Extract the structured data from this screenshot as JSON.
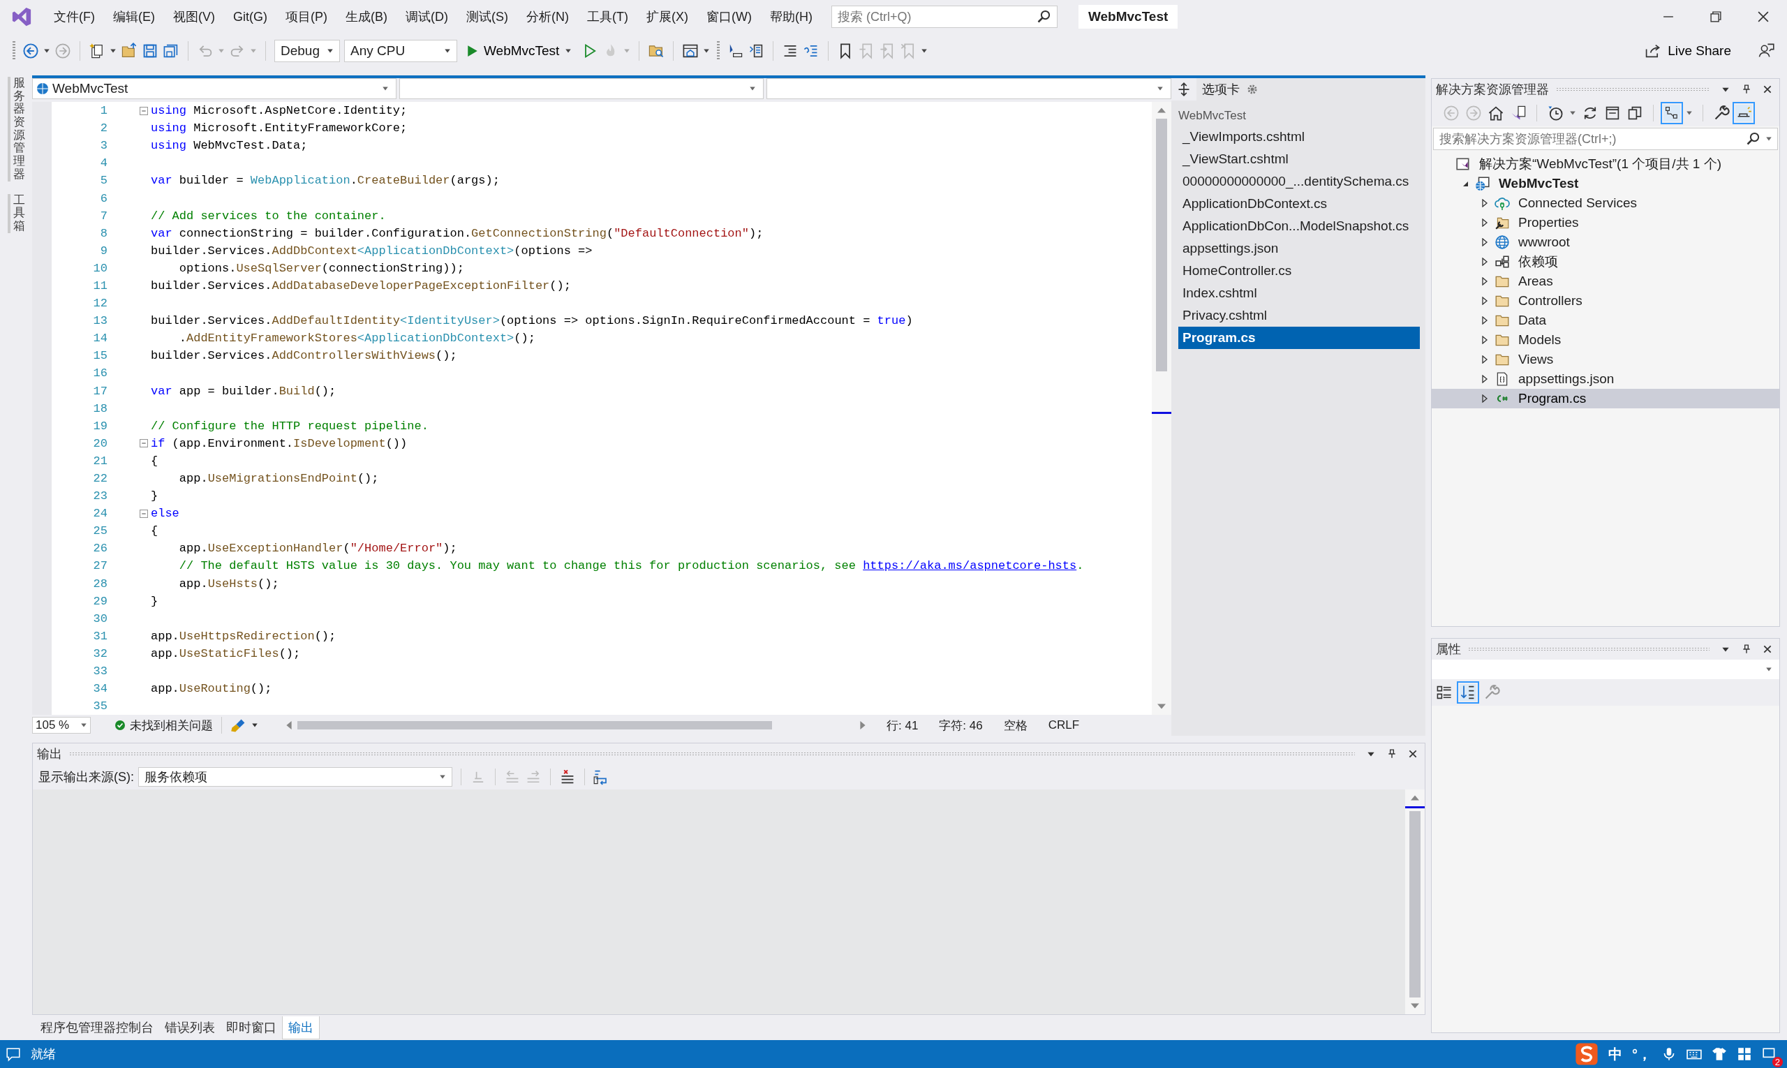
{
  "title_bar": {
    "menus": [
      "文件(F)",
      "编辑(E)",
      "视图(V)",
      "Git(G)",
      "项目(P)",
      "生成(B)",
      "调试(D)",
      "测试(S)",
      "分析(N)",
      "工具(T)",
      "扩展(X)",
      "窗口(W)",
      "帮助(H)"
    ],
    "search": {
      "placeholder": "搜索 (Ctrl+Q)"
    },
    "title": "WebMvcTest"
  },
  "toolbar": {
    "configuration": "Debug",
    "platform": "Any CPU",
    "start_label": "WebMvcTest",
    "live_share": "Live Share"
  },
  "side_strip": [
    "服务器资源管理器",
    "工具箱"
  ],
  "editor": {
    "project_dropdown": "WebMvcTest",
    "lines": [
      {
        "number": "1",
        "fold": true,
        "segments": [
          {
            "kind": "keyword",
            "text": "using"
          },
          {
            "kind": "plain",
            "text": " Microsoft.AspNetCore.Identity;"
          }
        ]
      },
      {
        "number": "2",
        "fold": false,
        "segments": [
          {
            "kind": "keyword",
            "text": "using"
          },
          {
            "kind": "plain",
            "text": " Microsoft.EntityFrameworkCore;"
          }
        ]
      },
      {
        "number": "3",
        "fold": false,
        "segments": [
          {
            "kind": "keyword",
            "text": "using"
          },
          {
            "kind": "plain",
            "text": " WebMvcTest.Data;"
          }
        ]
      },
      {
        "number": "4",
        "fold": false
      },
      {
        "number": "5",
        "fold": false,
        "segments": [
          {
            "kind": "keyword",
            "text": "var"
          },
          {
            "kind": "plain",
            "text": " builder = "
          },
          {
            "kind": "type",
            "text": "WebApplication"
          },
          {
            "kind": "plain",
            "text": "."
          },
          {
            "kind": "method",
            "text": "CreateBuilder"
          },
          {
            "kind": "plain",
            "text": "(args);"
          }
        ]
      },
      {
        "number": "6",
        "fold": false
      },
      {
        "number": "7",
        "fold": false,
        "segments": [
          {
            "kind": "comment",
            "text": "// Add services to the container."
          }
        ]
      },
      {
        "number": "8",
        "fold": false,
        "segments": [
          {
            "kind": "keyword",
            "text": "var"
          },
          {
            "kind": "plain",
            "text": " connectionString = builder.Configuration."
          },
          {
            "kind": "method",
            "text": "GetConnectionString"
          },
          {
            "kind": "plain",
            "text": "("
          },
          {
            "kind": "string",
            "text": "\"DefaultConnection\""
          },
          {
            "kind": "plain",
            "text": ");"
          }
        ]
      },
      {
        "number": "9",
        "fold": false,
        "segments": [
          {
            "kind": "plain",
            "text": "builder.Services."
          },
          {
            "kind": "method",
            "text": "AddDbContext"
          },
          {
            "kind": "type",
            "text": "<ApplicationDbContext>"
          },
          {
            "kind": "plain",
            "text": "(options =>"
          }
        ]
      },
      {
        "number": "10",
        "fold": false,
        "segments": [
          {
            "kind": "plain",
            "text": "    options."
          },
          {
            "kind": "method",
            "text": "UseSqlServer"
          },
          {
            "kind": "plain",
            "text": "(connectionString));"
          }
        ]
      },
      {
        "number": "11",
        "fold": false,
        "segments": [
          {
            "kind": "plain",
            "text": "builder.Services."
          },
          {
            "kind": "method",
            "text": "AddDatabaseDeveloperPageExceptionFilter"
          },
          {
            "kind": "plain",
            "text": "();"
          }
        ]
      },
      {
        "number": "12",
        "fold": false
      },
      {
        "number": "13",
        "fold": false,
        "segments": [
          {
            "kind": "plain",
            "text": "builder.Services."
          },
          {
            "kind": "method",
            "text": "AddDefaultIdentity"
          },
          {
            "kind": "type",
            "text": "<IdentityUser>"
          },
          {
            "kind": "plain",
            "text": "(options => options.SignIn.RequireConfirmedAccount = "
          },
          {
            "kind": "keyword",
            "text": "true"
          },
          {
            "kind": "plain",
            "text": ")"
          }
        ]
      },
      {
        "number": "14",
        "fold": false,
        "segments": [
          {
            "kind": "plain",
            "text": "    ."
          },
          {
            "kind": "method",
            "text": "AddEntityFrameworkStores"
          },
          {
            "kind": "type",
            "text": "<ApplicationDbContext>"
          },
          {
            "kind": "plain",
            "text": "();"
          }
        ]
      },
      {
        "number": "15",
        "fold": false,
        "segments": [
          {
            "kind": "plain",
            "text": "builder.Services."
          },
          {
            "kind": "method",
            "text": "AddControllersWithViews"
          },
          {
            "kind": "plain",
            "text": "();"
          }
        ]
      },
      {
        "number": "16",
        "fold": false
      },
      {
        "number": "17",
        "fold": false,
        "segments": [
          {
            "kind": "keyword",
            "text": "var"
          },
          {
            "kind": "plain",
            "text": " app = builder."
          },
          {
            "kind": "method",
            "text": "Build"
          },
          {
            "kind": "plain",
            "text": "();"
          }
        ]
      },
      {
        "number": "18",
        "fold": false
      },
      {
        "number": "19",
        "fold": false,
        "segments": [
          {
            "kind": "comment",
            "text": "// Configure the HTTP request pipeline."
          }
        ]
      },
      {
        "number": "20",
        "fold": true,
        "segments": [
          {
            "kind": "keyword",
            "text": "if"
          },
          {
            "kind": "plain",
            "text": " (app.Environment."
          },
          {
            "kind": "method",
            "text": "IsDevelopment"
          },
          {
            "kind": "plain",
            "text": "())"
          }
        ]
      },
      {
        "number": "21",
        "fold": false,
        "segments": [
          {
            "kind": "plain",
            "text": "{"
          }
        ]
      },
      {
        "number": "22",
        "fold": false,
        "segments": [
          {
            "kind": "plain",
            "text": "    app."
          },
          {
            "kind": "method",
            "text": "UseMigrationsEndPoint"
          },
          {
            "kind": "plain",
            "text": "();"
          }
        ]
      },
      {
        "number": "23",
        "fold": false,
        "segments": [
          {
            "kind": "plain",
            "text": "}"
          }
        ]
      },
      {
        "number": "24",
        "fold": true,
        "segments": [
          {
            "kind": "keyword",
            "text": "else"
          }
        ]
      },
      {
        "number": "25",
        "fold": false,
        "segments": [
          {
            "kind": "plain",
            "text": "{"
          }
        ]
      },
      {
        "number": "26",
        "fold": false,
        "segments": [
          {
            "kind": "plain",
            "text": "    app."
          },
          {
            "kind": "method",
            "text": "UseExceptionHandler"
          },
          {
            "kind": "plain",
            "text": "("
          },
          {
            "kind": "string",
            "text": "\"/Home/Error\""
          },
          {
            "kind": "plain",
            "text": ");"
          }
        ]
      },
      {
        "number": "27",
        "fold": false,
        "segments": [
          {
            "kind": "comment",
            "text": "    // The default HSTS value is 30 days. You may want to change this for production scenarios, see "
          },
          {
            "kind": "link",
            "text": "https://aka.ms/aspnetcore-hsts"
          },
          {
            "kind": "comment",
            "text": "."
          }
        ]
      },
      {
        "number": "28",
        "fold": false,
        "segments": [
          {
            "kind": "plain",
            "text": "    app."
          },
          {
            "kind": "method",
            "text": "UseHsts"
          },
          {
            "kind": "plain",
            "text": "();"
          }
        ]
      },
      {
        "number": "29",
        "fold": false,
        "segments": [
          {
            "kind": "plain",
            "text": "}"
          }
        ]
      },
      {
        "number": "30",
        "fold": false
      },
      {
        "number": "31",
        "fold": false,
        "segments": [
          {
            "kind": "plain",
            "text": "app."
          },
          {
            "kind": "method",
            "text": "UseHttpsRedirection"
          },
          {
            "kind": "plain",
            "text": "();"
          }
        ]
      },
      {
        "number": "32",
        "fold": false,
        "segments": [
          {
            "kind": "plain",
            "text": "app."
          },
          {
            "kind": "method",
            "text": "UseStaticFiles"
          },
          {
            "kind": "plain",
            "text": "();"
          }
        ]
      },
      {
        "number": "33",
        "fold": false
      },
      {
        "number": "34",
        "fold": false,
        "segments": [
          {
            "kind": "plain",
            "text": "app."
          },
          {
            "kind": "method",
            "text": "UseRouting"
          },
          {
            "kind": "plain",
            "text": "();"
          }
        ]
      },
      {
        "number": "35",
        "fold": false
      }
    ],
    "zoom": "105 %",
    "issues": "未找到相关问题",
    "position": [
      "行: 41",
      "字符: 46",
      "空格",
      "CRLF"
    ]
  },
  "open_tabs": {
    "title": "选项卡",
    "group": "WebMvcTest",
    "items": [
      {
        "label": "_ViewImports.cshtml",
        "selected": false
      },
      {
        "label": "_ViewStart.cshtml",
        "selected": false
      },
      {
        "label": "00000000000000_...dentitySchema.cs",
        "selected": false
      },
      {
        "label": "ApplicationDbContext.cs",
        "selected": false
      },
      {
        "label": "ApplicationDbCon...ModelSnapshot.cs",
        "selected": false
      },
      {
        "label": "appsettings.json",
        "selected": false
      },
      {
        "label": "HomeController.cs",
        "selected": false
      },
      {
        "label": "Index.cshtml",
        "selected": false
      },
      {
        "label": "Privacy.cshtml",
        "selected": false
      },
      {
        "label": "Program.cs",
        "selected": true
      }
    ]
  },
  "solution_explorer": {
    "title": "解决方案资源管理器",
    "search": {
      "placeholder": "搜索解决方案资源管理器(Ctrl+;)"
    },
    "tree": [
      {
        "label": "解决方案“WebMvcTest”(1 个项目/共 1 个)",
        "kind": "solution",
        "selected": false,
        "children": [
          {
            "label": "WebMvcTest",
            "kind": "project",
            "expanded": true,
            "selected": false,
            "children": [
              {
                "label": "Connected Services",
                "kind": "connected",
                "expanded": false,
                "selected": false
              },
              {
                "label": "Properties",
                "kind": "properties",
                "expanded": false,
                "selected": false
              },
              {
                "label": "wwwroot",
                "kind": "globe",
                "expanded": false,
                "selected": false
              },
              {
                "label": "依赖项",
                "kind": "dependencies",
                "expanded": false,
                "selected": false
              },
              {
                "label": "Areas",
                "kind": "folder",
                "expanded": false,
                "selected": false
              },
              {
                "label": "Controllers",
                "kind": "folder",
                "expanded": false,
                "selected": false
              },
              {
                "label": "Data",
                "kind": "folder",
                "expanded": false,
                "selected": false
              },
              {
                "label": "Models",
                "kind": "folder",
                "expanded": false,
                "selected": false
              },
              {
                "label": "Views",
                "kind": "folder",
                "expanded": false,
                "selected": false
              },
              {
                "label": "appsettings.json",
                "kind": "json",
                "expanded": false,
                "selected": false
              },
              {
                "label": "Program.cs",
                "kind": "csharp",
                "expanded": false,
                "selected": true
              }
            ]
          }
        ]
      }
    ]
  },
  "properties": {
    "title": "属性"
  },
  "output": {
    "title": "输出",
    "source_label": "显示输出来源(S):",
    "source": "服务依赖项"
  },
  "bottom_tabs": [
    {
      "label": "程序包管理器控制台",
      "selected": false
    },
    {
      "label": "错误列表",
      "selected": false
    },
    {
      "label": "即时窗口",
      "selected": false
    },
    {
      "label": "输出",
      "selected": true
    }
  ],
  "status_bar": {
    "text": "就绪",
    "ime": "中",
    "punctuation": "°，",
    "badge": "2"
  }
}
